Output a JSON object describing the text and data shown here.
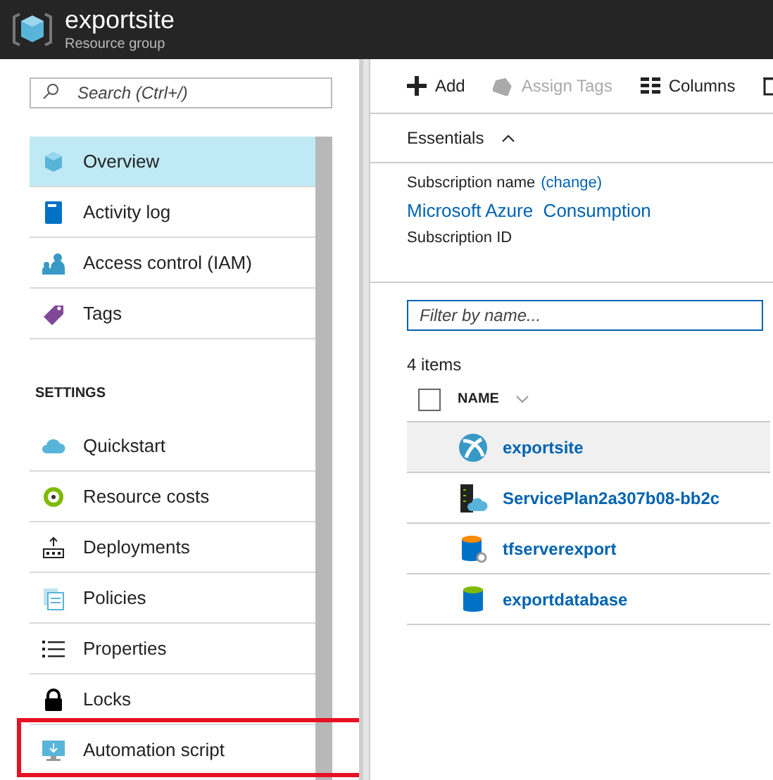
{
  "header": {
    "title": "exportsite",
    "subtitle": "Resource group"
  },
  "sidebar": {
    "search": {
      "placeholder": "Search (Ctrl+/)"
    },
    "items": [
      {
        "label": "Overview",
        "kind": "overview",
        "selected": true,
        "highlighted": false
      },
      {
        "label": "Activity log",
        "kind": "log",
        "selected": false,
        "highlighted": false
      },
      {
        "label": "Access control (IAM)",
        "kind": "iam",
        "selected": false,
        "highlighted": false
      },
      {
        "label": "Tags",
        "kind": "tag",
        "selected": false,
        "highlighted": false
      }
    ],
    "sections": [
      {
        "heading": "SETTINGS",
        "items": [
          {
            "label": "Quickstart",
            "kind": "cloud",
            "selected": false,
            "highlighted": false
          },
          {
            "label": "Resource costs",
            "kind": "cost",
            "selected": false,
            "highlighted": false
          },
          {
            "label": "Deployments",
            "kind": "deploy",
            "selected": false,
            "highlighted": false
          },
          {
            "label": "Policies",
            "kind": "policy",
            "selected": false,
            "highlighted": false
          },
          {
            "label": "Properties",
            "kind": "props",
            "selected": false,
            "highlighted": false
          },
          {
            "label": "Locks",
            "kind": "lock",
            "selected": false,
            "highlighted": false
          },
          {
            "label": "Automation script",
            "kind": "script",
            "selected": false,
            "highlighted": true
          }
        ]
      }
    ]
  },
  "toolbar": [
    {
      "label": "Add",
      "kind": "add",
      "disabled": false
    },
    {
      "label": "Assign Tags",
      "kind": "tag",
      "disabled": true
    },
    {
      "label": "Columns",
      "kind": "columns",
      "disabled": false
    }
  ],
  "essentials": {
    "title": "Essentials",
    "expanded": true,
    "subscription_label": "Subscription name",
    "change_link": "(change)",
    "subscription_value": "Microsoft Azure  Consumption",
    "subscription_id_label": "Subscription ID"
  },
  "filter": {
    "placeholder": "Filter by name..."
  },
  "count": "4 items",
  "table": {
    "checked": false,
    "column": "NAME",
    "rows": [
      {
        "name": "exportsite",
        "kind": "web",
        "selected": true
      },
      {
        "name": "ServicePlan2a307b08-bb2c",
        "kind": "plan",
        "selected": false
      },
      {
        "name": "tfserverexport",
        "kind": "sqlserver",
        "selected": false
      },
      {
        "name": "exportdatabase",
        "kind": "sqldb",
        "selected": false
      }
    ]
  }
}
